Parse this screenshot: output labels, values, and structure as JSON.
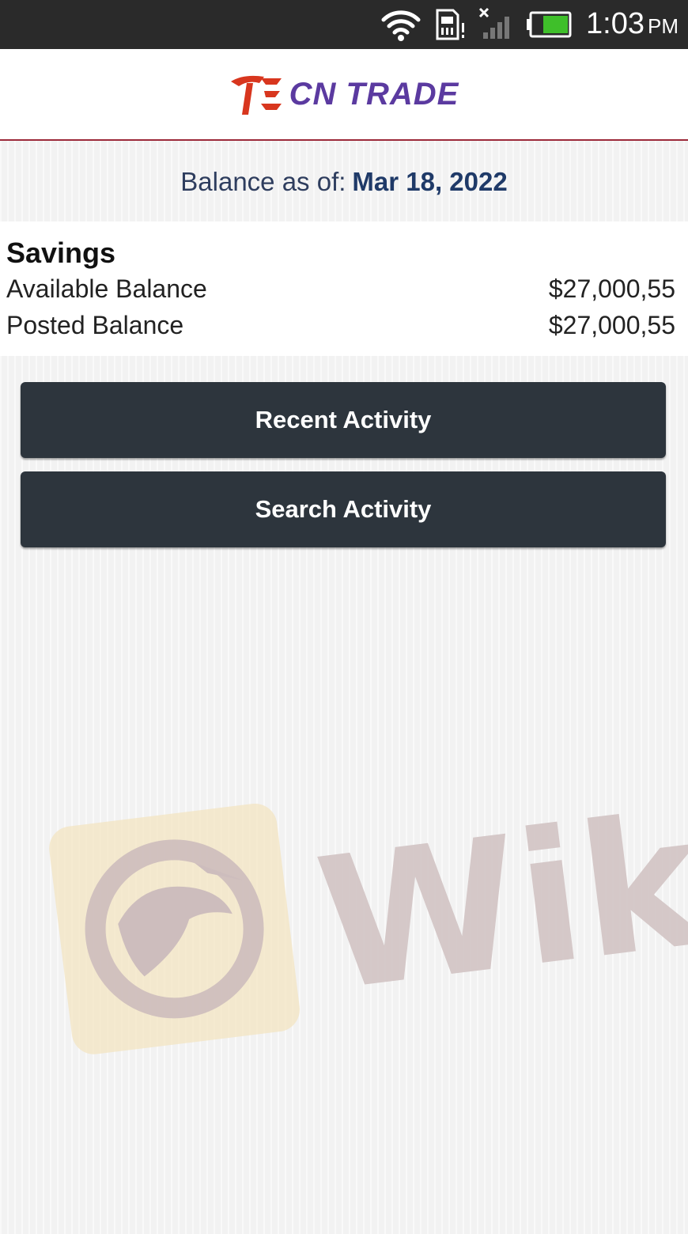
{
  "status_bar": {
    "time": "1:03",
    "ampm": "PM",
    "icons": [
      "wifi-icon",
      "sd-card-icon",
      "signal-no-service-icon",
      "battery-icon"
    ]
  },
  "header": {
    "logo_text": "CN TRADE",
    "logo_colors": {
      "mark": "#d8361e",
      "text": "#5b3aa0"
    }
  },
  "balance": {
    "label": "Balance as of:",
    "date": "Mar 18, 2022"
  },
  "account": {
    "name": "Savings",
    "rows": [
      {
        "label": "Available Balance",
        "value": "$27,000,55"
      },
      {
        "label": "Posted Balance",
        "value": "$27,000,55"
      }
    ]
  },
  "actions": {
    "recent": "Recent Activity",
    "search": "Search Activity"
  },
  "watermark": {
    "text": "Wiki",
    "icon": "eagle-icon"
  },
  "colors": {
    "button_bg": "#2d353d",
    "header_border": "#9c2a3a",
    "date_text": "#1f3a68"
  }
}
